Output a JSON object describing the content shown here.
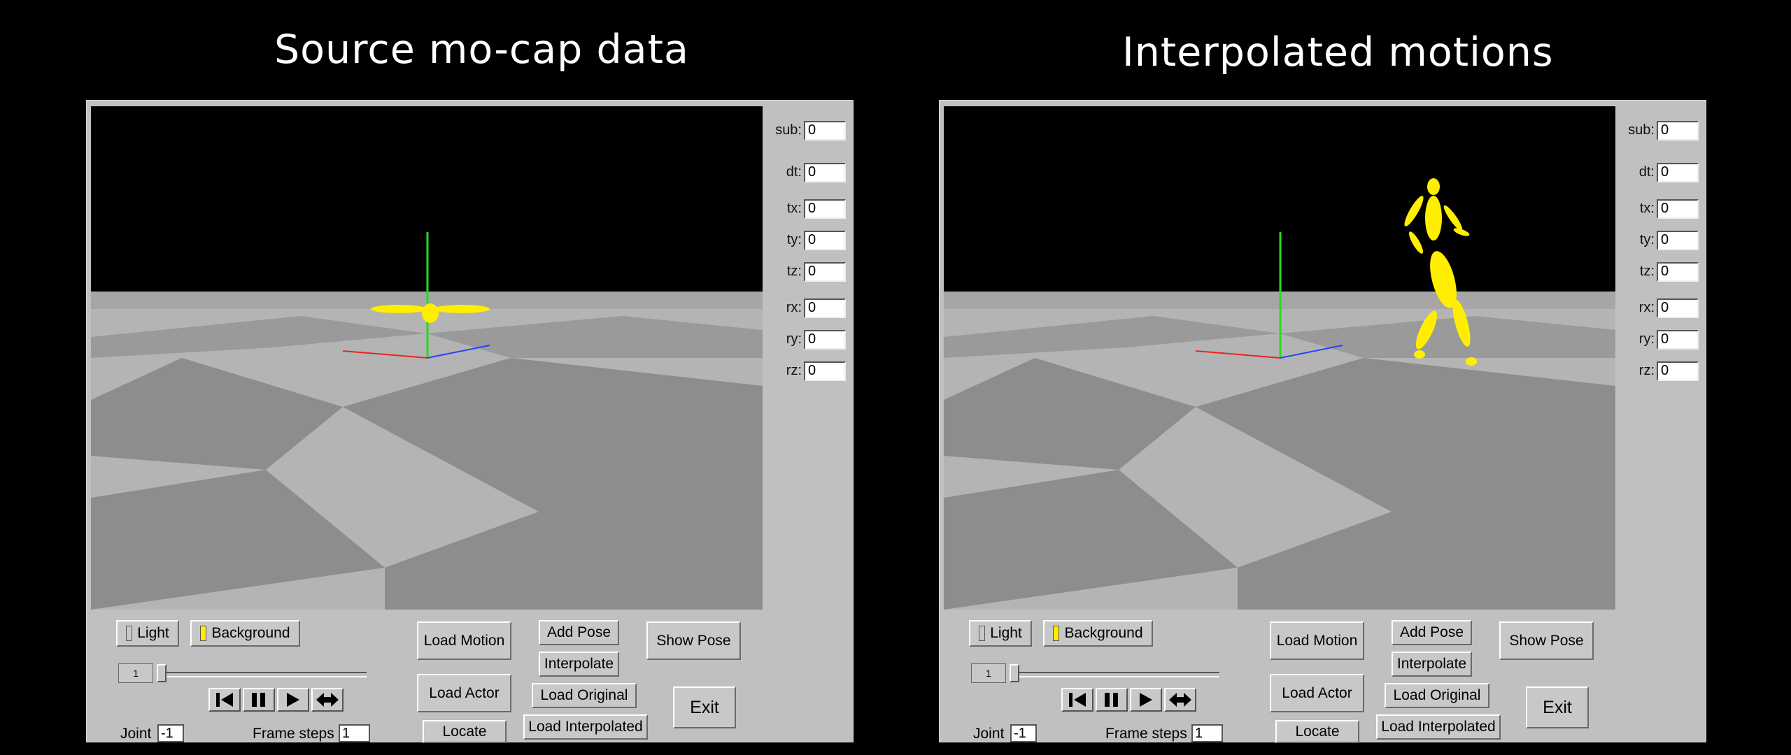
{
  "headings": {
    "left": "Source mo-cap data",
    "right": "Interpolated motions"
  },
  "fields": [
    {
      "label": "sub:",
      "value": "0"
    },
    {
      "label": "dt:",
      "value": "0"
    },
    {
      "label": "tx:",
      "value": "0"
    },
    {
      "label": "ty:",
      "value": "0"
    },
    {
      "label": "tz:",
      "value": "0"
    },
    {
      "label": "rx:",
      "value": "0"
    },
    {
      "label": "ry:",
      "value": "0"
    },
    {
      "label": "rz:",
      "value": "0"
    }
  ],
  "toggles": {
    "light": "Light",
    "background": "Background"
  },
  "buttons": {
    "load_motion": "Load Motion",
    "load_actor": "Load Actor",
    "locate": "Locate",
    "add_pose": "Add Pose",
    "interpolate": "Interpolate",
    "load_original": "Load Original",
    "load_interpolated": "Load Interpolated",
    "show_pose": "Show Pose",
    "exit": "Exit"
  },
  "playback": {
    "frame": "1",
    "icons": [
      "skip-to-start-icon",
      "pause-icon",
      "play-icon",
      "loop-icon"
    ]
  },
  "joint": {
    "label": "Joint",
    "value": "-1"
  },
  "frame_steps": {
    "label": "Frame steps",
    "value": "1"
  },
  "colors": {
    "figure": "#ffee00",
    "floor_light": "#c8c8c8",
    "floor_dark": "#8c8c8c",
    "panel": "#c0c0c0"
  }
}
